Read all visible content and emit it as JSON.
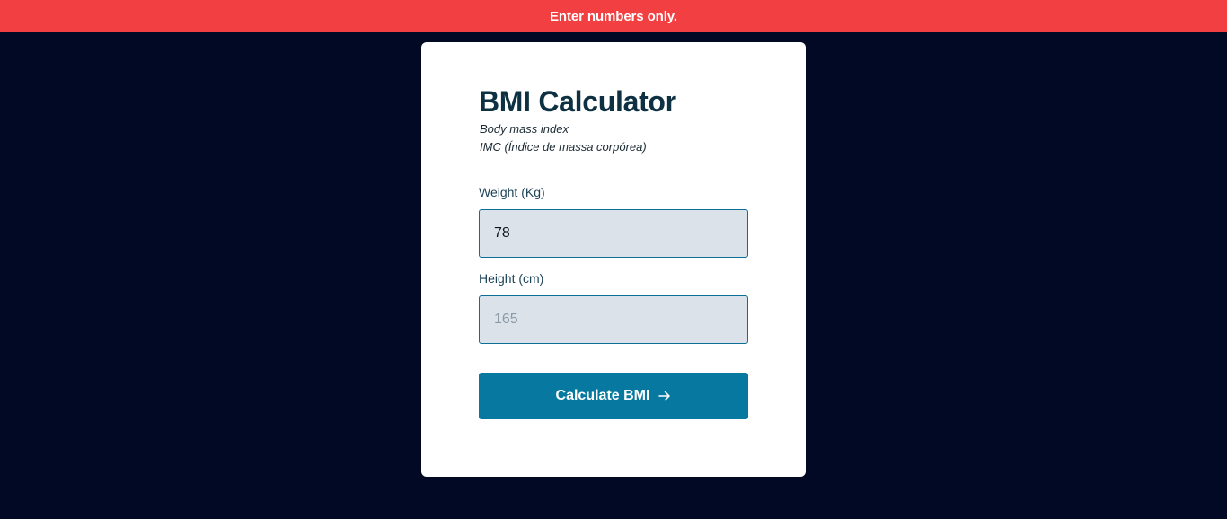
{
  "alert": {
    "message": "Enter numbers only."
  },
  "card": {
    "title": "BMI Calculator",
    "subtitle_line1": "Body mass index",
    "subtitle_line2": "IMC (Índice de massa corpórea)"
  },
  "weight": {
    "label": "Weight (Kg)",
    "value": "78",
    "placeholder": ""
  },
  "height": {
    "label": "Height (cm)",
    "value": "",
    "placeholder": "165"
  },
  "button": {
    "label": "Calculate BMI",
    "icon": "arrow-right-icon"
  },
  "colors": {
    "alert_bg": "#f23f41",
    "page_bg": "#020924",
    "button_bg": "#0779a0",
    "title": "#0d3142",
    "input_bg": "#dbe2ea",
    "input_border": "#0e6f96"
  }
}
